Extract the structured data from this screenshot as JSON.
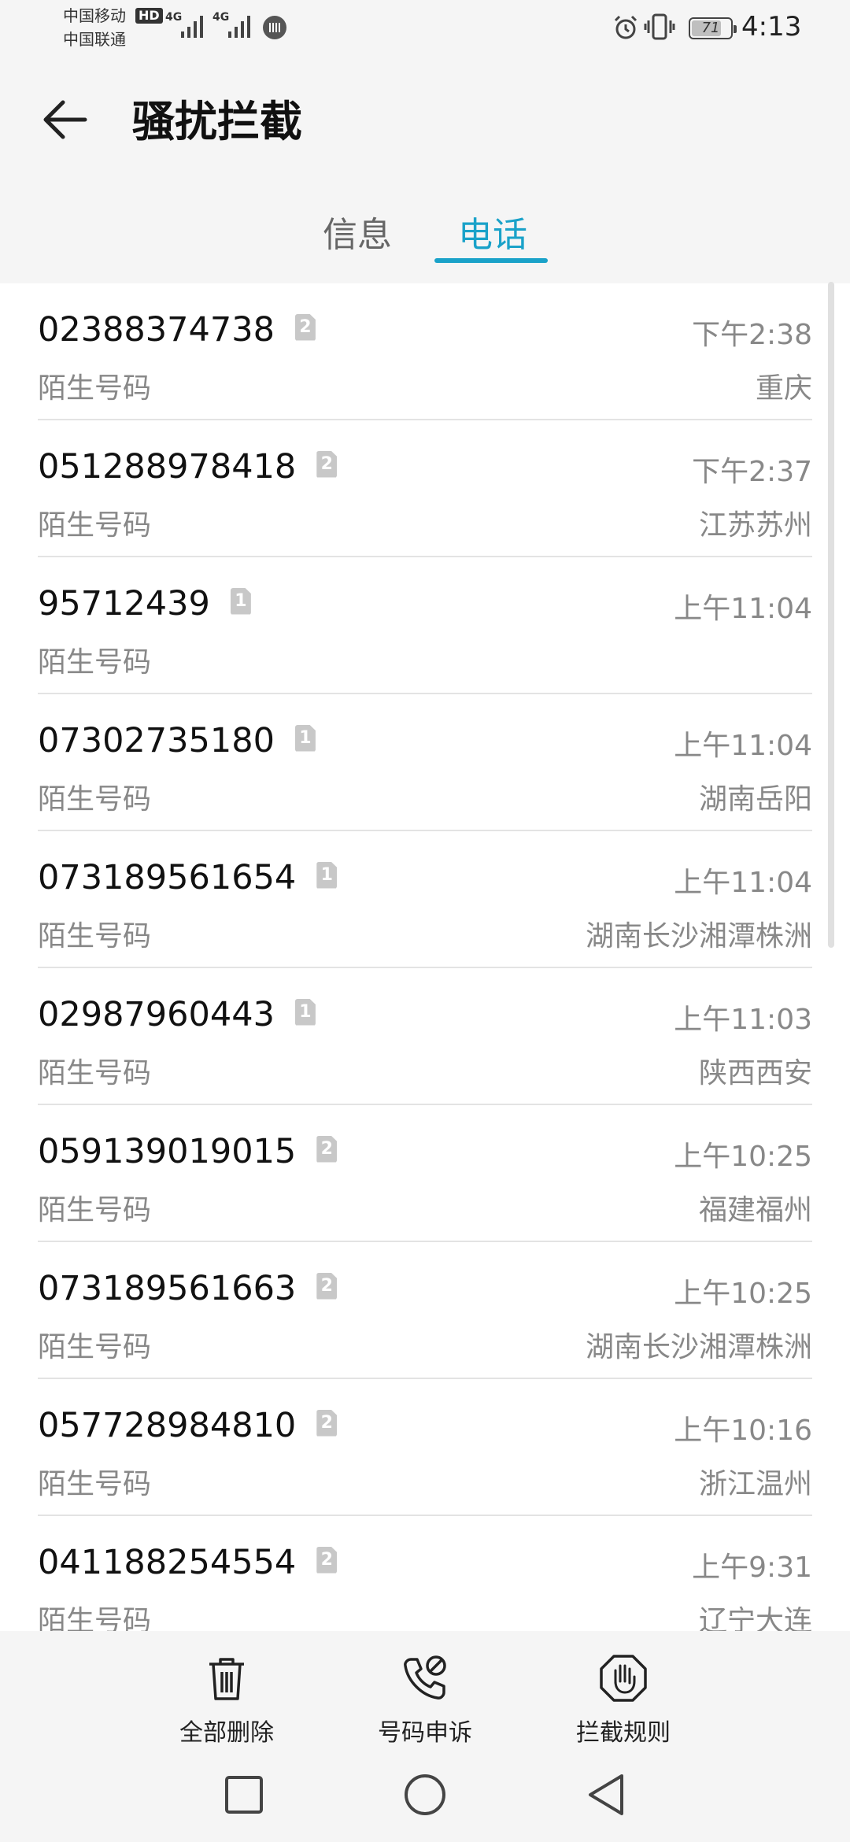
{
  "status": {
    "carrier1": "中国移动",
    "carrier2": "中国联通",
    "hd": "HD",
    "net1": "4G",
    "net2": "4G",
    "battery": "71",
    "battery_level": 0.71,
    "time": "4:13"
  },
  "header": {
    "title": "骚扰拦截",
    "tabs": [
      {
        "label": "信息",
        "active": false
      },
      {
        "label": "电话",
        "active": true
      }
    ]
  },
  "accent_color": "#1aa2c9",
  "calls": [
    {
      "number": "02388374738",
      "sim": "2",
      "label": "陌生号码",
      "time": "下午2:38",
      "location": "重庆"
    },
    {
      "number": "051288978418",
      "sim": "2",
      "label": "陌生号码",
      "time": "下午2:37",
      "location": "江苏苏州"
    },
    {
      "number": "95712439",
      "sim": "1",
      "label": "陌生号码",
      "time": "上午11:04",
      "location": ""
    },
    {
      "number": "07302735180",
      "sim": "1",
      "label": "陌生号码",
      "time": "上午11:04",
      "location": "湖南岳阳"
    },
    {
      "number": "073189561654",
      "sim": "1",
      "label": "陌生号码",
      "time": "上午11:04",
      "location": "湖南长沙湘潭株洲"
    },
    {
      "number": "02987960443",
      "sim": "1",
      "label": "陌生号码",
      "time": "上午11:03",
      "location": "陕西西安"
    },
    {
      "number": "059139019015",
      "sim": "2",
      "label": "陌生号码",
      "time": "上午10:25",
      "location": "福建福州"
    },
    {
      "number": "073189561663",
      "sim": "2",
      "label": "陌生号码",
      "time": "上午10:25",
      "location": "湖南长沙湘潭株洲"
    },
    {
      "number": "057728984810",
      "sim": "2",
      "label": "陌生号码",
      "time": "上午10:16",
      "location": "浙江温州"
    },
    {
      "number": "041188254554",
      "sim": "2",
      "label": "陌生号码",
      "time": "上午9:31",
      "location": "辽宁大连"
    }
  ],
  "actions": {
    "delete_all": "全部删除",
    "appeal": "号码申诉",
    "rules": "拦截规则"
  },
  "icons": {
    "back": "arrow-left-icon",
    "delete": "trash-icon",
    "appeal": "phone-blocked-icon",
    "rules": "hand-stop-icon"
  }
}
